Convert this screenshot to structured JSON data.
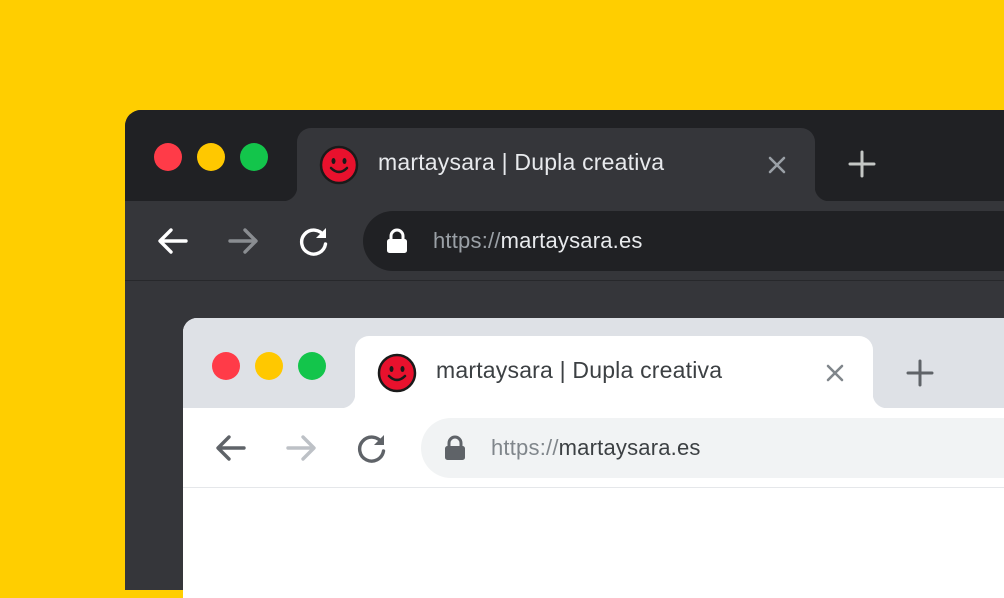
{
  "colors": {
    "background": "#FFCE00",
    "dark_frame": "#202124",
    "dark_toolbar": "#35363A",
    "light_frame": "#DEE1E6",
    "light_toolbar": "#FFFFFF",
    "traffic_red": "#FF3B48",
    "traffic_yellow": "#FFC800",
    "traffic_green": "#13C54B",
    "favicon_red": "#E8112D"
  },
  "dark_window": {
    "tab": {
      "title": "martaysara | Dupla creativa",
      "favicon": "smiley-face-icon",
      "close_icon": "close-icon"
    },
    "new_tab_icon": "plus-icon",
    "nav_icons": [
      "back-arrow-icon",
      "forward-arrow-icon",
      "reload-icon"
    ],
    "address_bar": {
      "scheme": "https://",
      "host": "martaysara.es",
      "lock_icon": "lock-icon"
    }
  },
  "light_window": {
    "tab": {
      "title": "martaysara | Dupla creativa",
      "favicon": "smiley-face-icon",
      "close_icon": "close-icon"
    },
    "new_tab_icon": "plus-icon",
    "nav_icons": [
      "back-arrow-icon",
      "forward-arrow-icon",
      "reload-icon"
    ],
    "address_bar": {
      "scheme": "https://",
      "host": "martaysara.es",
      "lock_icon": "lock-icon"
    }
  }
}
